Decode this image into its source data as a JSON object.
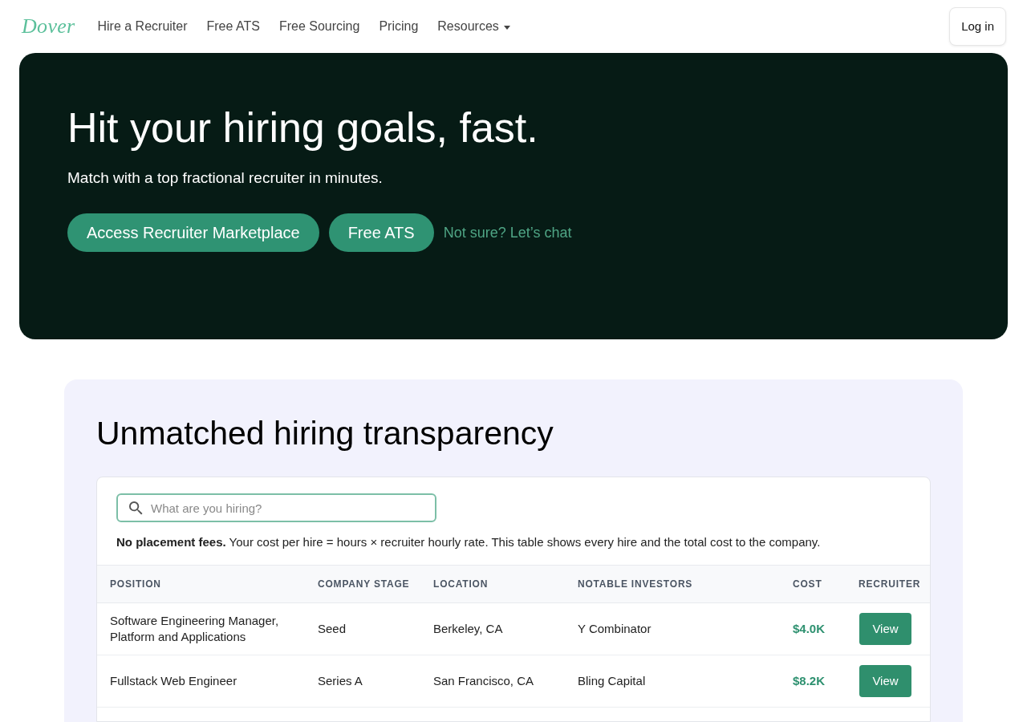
{
  "nav": {
    "logo": "Dover",
    "links": [
      {
        "label": "Hire a Recruiter",
        "dropdown": false
      },
      {
        "label": "Free ATS",
        "dropdown": false
      },
      {
        "label": "Free Sourcing",
        "dropdown": false
      },
      {
        "label": "Pricing",
        "dropdown": false
      },
      {
        "label": "Resources",
        "dropdown": true
      }
    ],
    "login_button": "Log in"
  },
  "hero": {
    "title": "Hit your hiring goals, fast.",
    "subtitle": "Match with a top fractional recruiter in minutes.",
    "buttons": [
      "Access Recruiter Marketplace",
      "Free ATS"
    ],
    "link": "Not sure? Let’s chat"
  },
  "transparency": {
    "title": "Unmatched hiring transparency",
    "search": {
      "placeholder": "What are you hiring?"
    },
    "note": "**No placement fees.** Your cost per hire = hours × recruiter hourly rate. This table shows every hire and the total cost to the company.",
    "table": {
      "columns": [
        "POSITION",
        "COMPANY STAGE",
        "LOCATION",
        "NOTABLE INVESTORS",
        "COST",
        "RECRUITER"
      ],
      "rows": [
        {
          "position": "Software Engineering Manager, Platform and Applications",
          "company_stage": "Seed",
          "location": "Berkeley, CA",
          "notable_investors": "Y Combinator",
          "cost": "$4.0K",
          "recruiter": "View"
        },
        {
          "position": "Fullstack Web Engineer",
          "company_stage": "Series A",
          "location": "San Francisco, CA",
          "notable_investors": "Bling Capital",
          "cost": "$8.2K",
          "recruiter": "View"
        }
      ]
    }
  }
}
